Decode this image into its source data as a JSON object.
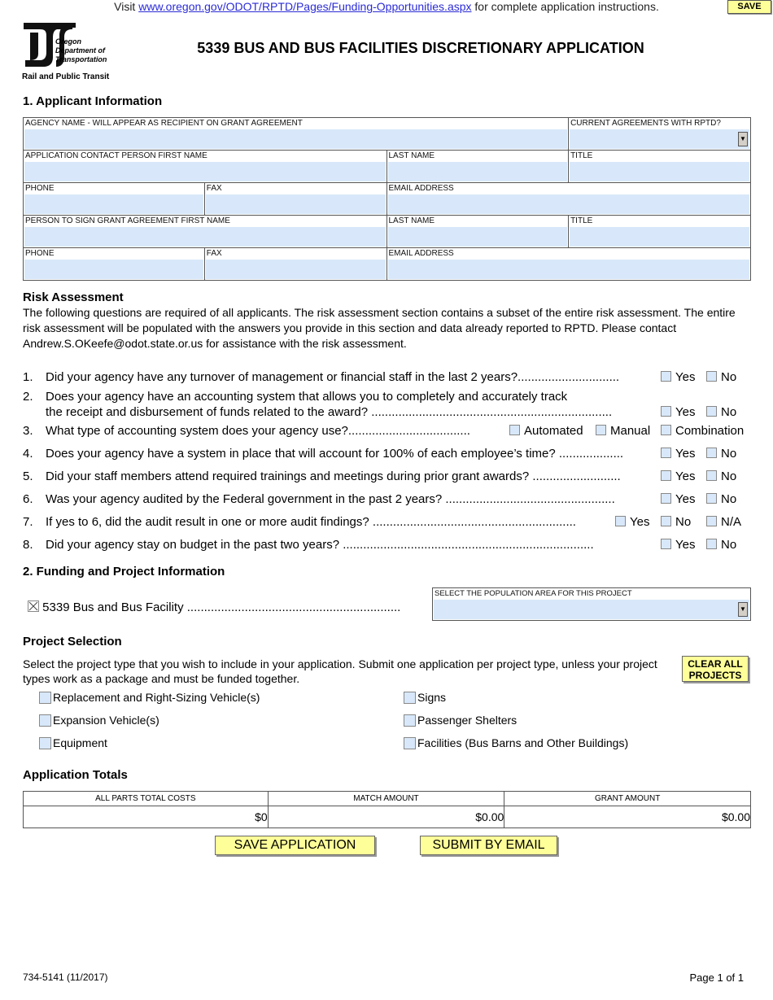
{
  "header": {
    "visit_prefix": "Visit",
    "link_text": "www.oregon.gov/ODOT/RPTD/Pages/Funding-Opportunities.aspx",
    "visit_suffix": "for complete application instructions.",
    "save_label": "SAVE",
    "logo": {
      "line1": "Oregon",
      "line2": "Department of",
      "line3": "Transportation",
      "subtitle": "Rail and Public Transit"
    },
    "title": "5339 BUS AND BUS FACILITIES DISCRETIONARY APPLICATION"
  },
  "applicant": {
    "heading": "1. Applicant Information",
    "agency_name_label": "AGENCY NAME - WILL APPEAR AS RECIPIENT ON GRANT AGREEMENT",
    "agency_name_value": "",
    "current_agreements_label": "CURRENT AGREEMENTS WITH RPTD?",
    "current_agreements_value": "",
    "contact_first_label": "APPLICATION CONTACT PERSON FIRST NAME",
    "contact_last_label": "LAST NAME",
    "contact_title_label": "TITLE",
    "contact_phone_label": "PHONE",
    "contact_fax_label": "FAX",
    "contact_email_label": "EMAIL ADDRESS",
    "signer_first_label": "PERSON TO SIGN GRANT AGREEMENT FIRST NAME",
    "signer_last_label": "LAST NAME",
    "signer_title_label": "TITLE",
    "signer_phone_label": "PHONE",
    "signer_fax_label": "FAX",
    "signer_email_label": "EMAIL ADDRESS"
  },
  "risk": {
    "heading": "Risk Assessment",
    "intro": "The following questions are required of all applicants. The risk assessment section contains a subset of the entire risk assessment. The entire risk assessment will be populated with the answers you provide in this section and data already reported to RPTD. Please contact Andrew.S.OKeefe@odot.state.or.us for assistance with the risk assessment.",
    "questions": [
      {
        "num": "1.",
        "text": "Did your agency have any turnover of management or financial staff in the last 2 years?..............................",
        "options": [
          "Yes",
          "No"
        ]
      },
      {
        "num": "2.",
        "text": "Does your agency have an accounting system that allows you to completely and accurately track",
        "text2": "the receipt and disbursement of funds related to the award? .......................................................................",
        "options": [
          "Yes",
          "No"
        ]
      },
      {
        "num": "3.",
        "text": "What type of accounting system does your agency use?....................................",
        "options": [
          "Automated",
          "Manual",
          "Combination"
        ]
      },
      {
        "num": "4.",
        "text": "Does your agency have a system in place that will account for 100% of each employee’s time? ...................",
        "options": [
          "Yes",
          "No"
        ]
      },
      {
        "num": "5.",
        "text": "Did your staff members attend required trainings and meetings during prior grant awards? ..........................",
        "options": [
          "Yes",
          "No"
        ]
      },
      {
        "num": "6.",
        "text": "Was your agency audited by the Federal government in the past 2 years? ..................................................",
        "options": [
          "Yes",
          "No"
        ]
      },
      {
        "num": "7.",
        "text": "If yes to 6, did the audit result in one or more audit findings? ............................................................",
        "options": [
          "Yes",
          "No",
          "N/A"
        ]
      },
      {
        "num": "8.",
        "text": "Did your agency stay on budget in the past two years? ..........................................................................",
        "options": [
          "Yes",
          "No"
        ]
      }
    ]
  },
  "funding": {
    "heading": "2. Funding and Project Information",
    "program_label": "5339 Bus and Bus Facility ...............................................................",
    "program_checked": true,
    "population_label": "SELECT THE POPULATION AREA FOR THIS PROJECT",
    "population_value": ""
  },
  "projects": {
    "heading": "Project Selection",
    "intro": "Select the project type that you wish to include in your application. Submit one application per project type, unless your project types work as a package and must be funded together.",
    "clear_label_1": "CLEAR ALL",
    "clear_label_2": "PROJECTS",
    "left": [
      "Replacement and Right-Sizing Vehicle(s)",
      "Expansion Vehicle(s)",
      "Equipment"
    ],
    "right": [
      "Signs",
      "Passenger Shelters",
      "Facilities (Bus Barns and Other Buildings)"
    ]
  },
  "totals": {
    "heading": "Application Totals",
    "columns": [
      "ALL PARTS TOTAL COSTS",
      "MATCH AMOUNT",
      "GRANT AMOUNT"
    ],
    "values": [
      "$0",
      "$0.00",
      "$0.00"
    ]
  },
  "actions": {
    "save_application": "SAVE APPLICATION",
    "submit_email": "SUBMIT BY EMAIL"
  },
  "footer": {
    "form_number": "734-5141 (11/2017)",
    "page": "Page 1 of 1"
  }
}
